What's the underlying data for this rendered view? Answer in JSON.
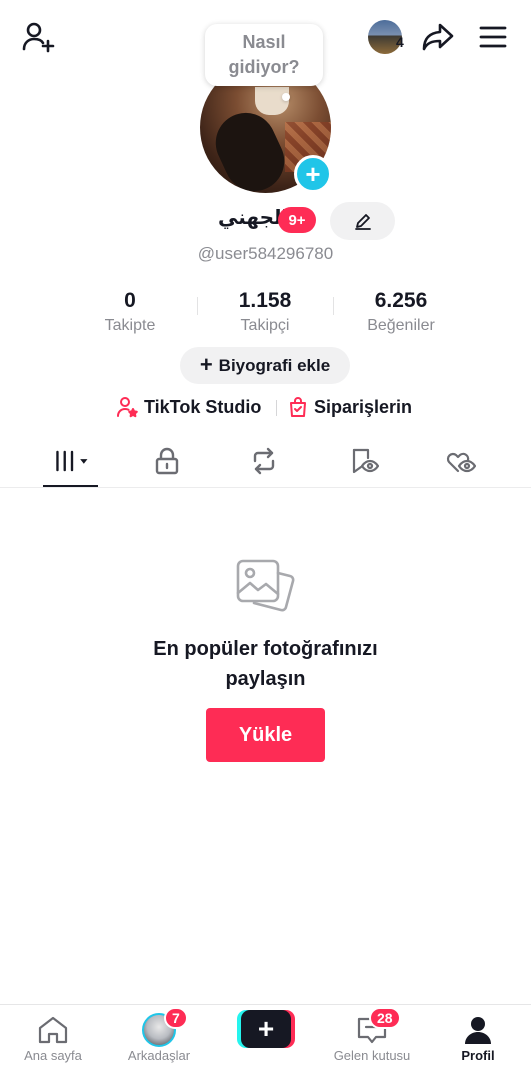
{
  "header": {
    "story_count": "4",
    "thought_bubble": [
      "Nasıl",
      "gidiyor?"
    ]
  },
  "profile": {
    "display_name": "الجهني",
    "name_badge": "9+",
    "username": "@user584296780"
  },
  "stats": [
    {
      "value": "0",
      "label": "Takipte"
    },
    {
      "value": "1.158",
      "label": "Takipçi"
    },
    {
      "value": "6.256",
      "label": "Beğeniler"
    }
  ],
  "actions": {
    "bio_label": "Biyografi ekle",
    "studio_label": "TikTok Studio",
    "orders_label": "Siparişlerin"
  },
  "tabs": [
    {
      "name": "videos",
      "icon": "grid-icon",
      "active": true
    },
    {
      "name": "private",
      "icon": "lock-icon"
    },
    {
      "name": "reposts",
      "icon": "repost-icon"
    },
    {
      "name": "favorites",
      "icon": "bookmark-eye-icon"
    },
    {
      "name": "liked",
      "icon": "heart-eye-icon"
    }
  ],
  "empty_state": {
    "title_line1": "En popüler fotoğrafınızı",
    "title_line2": "paylaşın",
    "upload_label": "Yükle"
  },
  "bottom_nav": {
    "home_label": "Ana sayfa",
    "friends_label": "Arkadaşlar",
    "friends_badge": "7",
    "inbox_label": "Gelen kutusu",
    "inbox_badge": "28",
    "profile_label": "Profil"
  },
  "colors": {
    "accent": "#fe2c55",
    "cyan": "#20c5e8",
    "text": "#161823",
    "secondary_text": "#8a8b91"
  }
}
